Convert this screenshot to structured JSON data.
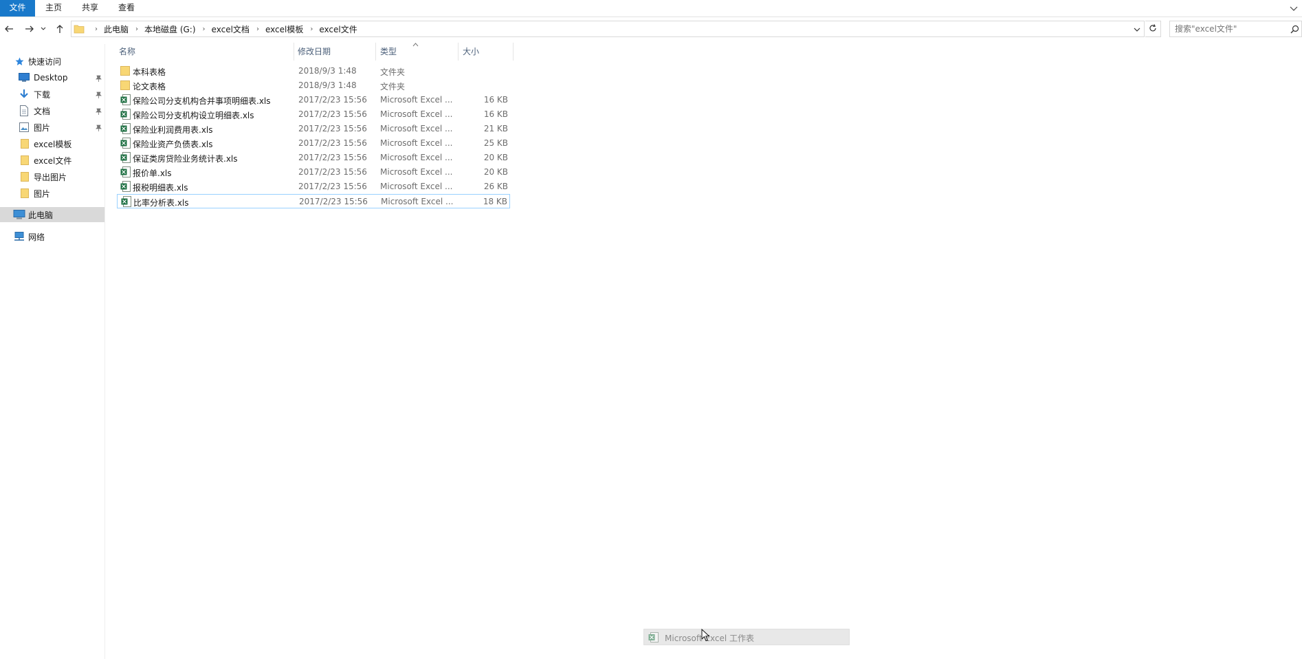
{
  "ribbon": {
    "file": "文件",
    "home": "主页",
    "share": "共享",
    "view": "查看"
  },
  "address": {
    "crumbs": [
      "此电脑",
      "本地磁盘 (G:)",
      "excel文档",
      "excel模板",
      "excel文件"
    ],
    "separator": "›"
  },
  "search": {
    "placeholder": "搜索\"excel文件\""
  },
  "navpane": {
    "quick_access": "快速访问",
    "items": [
      {
        "label": "Desktop",
        "icon": "desktop-icon",
        "pinned": true
      },
      {
        "label": "下载",
        "icon": "download-icon",
        "pinned": true
      },
      {
        "label": "文档",
        "icon": "document-icon",
        "pinned": true
      },
      {
        "label": "图片",
        "icon": "pictures-icon",
        "pinned": true
      },
      {
        "label": "excel模板",
        "icon": "folder-icon",
        "pinned": false
      },
      {
        "label": "excel文件",
        "icon": "folder-icon",
        "pinned": false
      },
      {
        "label": "导出图片",
        "icon": "folder-icon",
        "pinned": false
      },
      {
        "label": "图片",
        "icon": "folder-icon",
        "pinned": false
      }
    ],
    "this_pc": "此电脑",
    "network": "网络"
  },
  "columns": {
    "name": "名称",
    "date": "修改日期",
    "type": "类型",
    "size": "大小"
  },
  "files": [
    {
      "name": "本科表格",
      "date": "2018/9/3 1:48",
      "type": "文件夹",
      "size": "",
      "kind": "folder"
    },
    {
      "name": "论文表格",
      "date": "2018/9/3 1:48",
      "type": "文件夹",
      "size": "",
      "kind": "folder"
    },
    {
      "name": "保险公司分支机构合并事项明细表.xls",
      "date": "2017/2/23 15:56",
      "type": "Microsoft Excel ...",
      "size": "16 KB",
      "kind": "excel"
    },
    {
      "name": "保险公司分支机构设立明细表.xls",
      "date": "2017/2/23 15:56",
      "type": "Microsoft Excel ...",
      "size": "16 KB",
      "kind": "excel"
    },
    {
      "name": "保险业利润费用表.xls",
      "date": "2017/2/23 15:56",
      "type": "Microsoft Excel ...",
      "size": "21 KB",
      "kind": "excel"
    },
    {
      "name": "保险业资产负债表.xls",
      "date": "2017/2/23 15:56",
      "type": "Microsoft Excel ...",
      "size": "25 KB",
      "kind": "excel"
    },
    {
      "name": "保证类房贷险业务统计表.xls",
      "date": "2017/2/23 15:56",
      "type": "Microsoft Excel ...",
      "size": "20 KB",
      "kind": "excel"
    },
    {
      "name": "报价单.xls",
      "date": "2017/2/23 15:56",
      "type": "Microsoft Excel ...",
      "size": "20 KB",
      "kind": "excel"
    },
    {
      "name": "报税明细表.xls",
      "date": "2017/2/23 15:56",
      "type": "Microsoft Excel ...",
      "size": "26 KB",
      "kind": "excel"
    },
    {
      "name": "比率分析表.xls",
      "date": "2017/2/23 15:56",
      "type": "Microsoft Excel ...",
      "size": "18 KB",
      "kind": "excel",
      "selected": true
    }
  ],
  "tooltip": {
    "text": "Microsoft Excel 工作表"
  },
  "colors": {
    "accent": "#1979ca",
    "folder": "#f8d775",
    "excel": "#1d6f42",
    "selection_border": "#99d1ff",
    "header_text": "#4c607a"
  }
}
